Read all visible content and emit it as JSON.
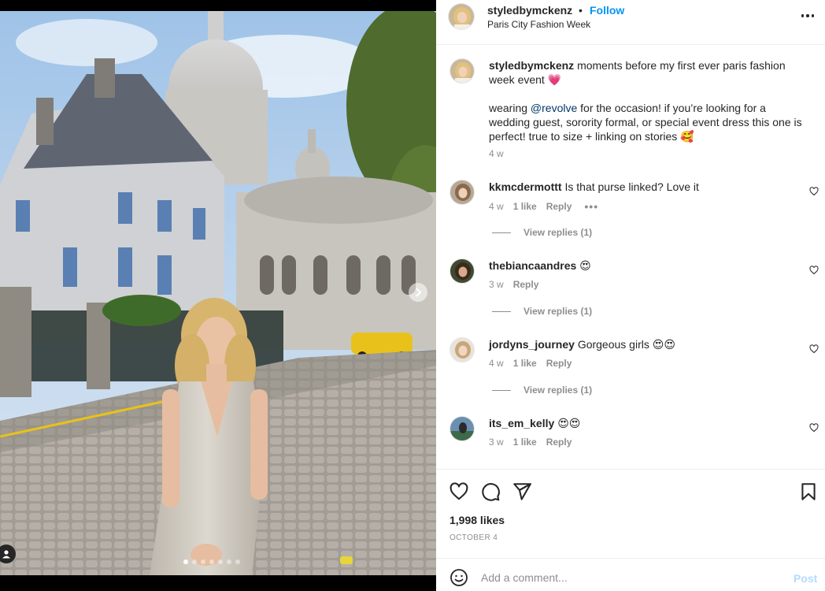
{
  "post": {
    "username": "styledbymckenz",
    "separator": "•",
    "follow_label": "Follow",
    "location": "Paris City Fashion Week",
    "media": {
      "image_count": 7,
      "active_index": 0
    }
  },
  "caption": {
    "username": "styledbymckenz",
    "line1": "moments before my first ever paris fashion week event 💗",
    "line2_prefix": "wearing ",
    "mention": "@revolve",
    "line2_suffix": " for the occasion! if you’re looking for a wedding guest, sorority formal, or special event dress this one is perfect! true to size + linking on stories 🥰",
    "time": "4 w"
  },
  "comments": [
    {
      "username": "kkmcdermottt",
      "text": "Is that purse linked? Love it",
      "time": "4 w",
      "likes": "1 like",
      "reply": "Reply",
      "more": "•••",
      "view_replies": "View replies (1)"
    },
    {
      "username": "thebiancaandres",
      "text": "😍",
      "time": "3 w",
      "likes": "",
      "reply": "Reply",
      "view_replies": "View replies (1)"
    },
    {
      "username": "jordyns_journey",
      "text": "Gorgeous girls 😍😍",
      "time": "4 w",
      "likes": "1 like",
      "reply": "Reply",
      "view_replies": "View replies (1)"
    },
    {
      "username": "its_em_kelly",
      "text": "😍😍",
      "time": "3 w",
      "likes": "1 like",
      "reply": "Reply"
    }
  ],
  "actions": {
    "like_count": "1,998 likes",
    "date": "OCTOBER 4"
  },
  "add_comment": {
    "placeholder": "Add a comment...",
    "post_label": "Post"
  },
  "colors": {
    "accent": "#0095f6",
    "post_disabled": "#b3dbff",
    "secondary_text": "#8e8e8e",
    "mention": "#00376b"
  }
}
